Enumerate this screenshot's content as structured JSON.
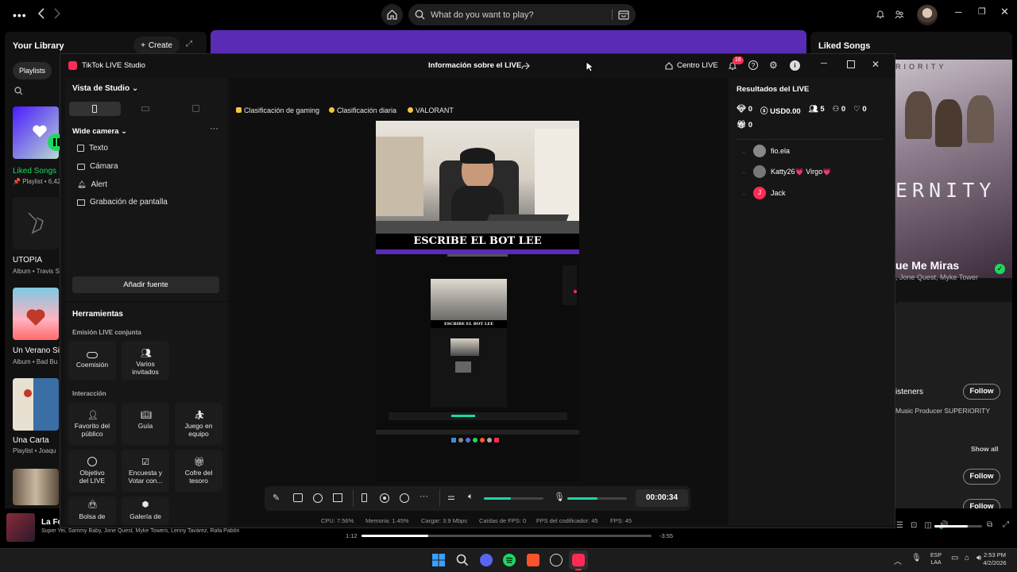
{
  "spotify": {
    "search_placeholder": "What do you want to play?",
    "library_title": "Your Library",
    "create_label": "Create",
    "filter_playlists": "Playlists",
    "library_items": [
      {
        "title": "Liked Songs",
        "subtitle": "Playlist • 6,42",
        "color": "#7b4bff"
      },
      {
        "title": "UTOPIA",
        "subtitle": "Album • Travis S",
        "color": "#2a2a2a"
      },
      {
        "title": "Un Verano Sin",
        "subtitle": "Album • Bad Bu",
        "color": "#ff6b6b"
      },
      {
        "title": "Una Carta",
        "subtitle": "Playlist • Joaqu",
        "color": "#3a6ea5"
      }
    ],
    "right_title": "Liked Songs",
    "banner_text": "ERNITY",
    "banner_top_text": "RIORITY",
    "track_title": "ue Me Miras",
    "track_artists": ", Jone Quest, Myke Tower",
    "listeners_label": "isteners",
    "follow_label": "Follow",
    "producer_text": "Music Producer SUPERIORITY",
    "show_all": "Show all",
    "follow2_label": "Follow",
    "follow3_label": "Follow",
    "now_playing_title": "La Fo",
    "now_playing_artists": "Super Yei, Sammy Baby, Jone Quest, Myke Towers, Lenny Tavárez, Rafa Pabön",
    "elapsed": "1:12",
    "remaining": "-3:55",
    "progress_fraction": 0.23,
    "volume_fraction": 0.7
  },
  "tiktok": {
    "app_title": "TikTok LIVE Studio",
    "live_info": "Información sobre el LIVE",
    "centro_live": "Centro LIVE",
    "notif_count": "16",
    "vista_label": "Vista de Studio",
    "scene_name": "Wide camera",
    "sources": [
      {
        "name": "Texto",
        "icon": "text-icon"
      },
      {
        "name": "Cámara",
        "icon": "camera-icon"
      },
      {
        "name": "Alert",
        "icon": "bell-icon"
      },
      {
        "name": "Grabación de pantalla",
        "icon": "monitor-icon"
      }
    ],
    "add_source": "Añadir fuente",
    "tools_title": "Herramientas",
    "section_joint": "Emisión LIVE conjunta",
    "joint_tools": [
      "Coemisión",
      "Varios invitados"
    ],
    "section_interaction": "Interacción",
    "interaction_tools": [
      "Favorito del público",
      "Guía",
      "Juego en equipo",
      "Objetivo del LIVE",
      "Encuesta y Votar con...",
      "Cofre del tesoro",
      "Bolsa de",
      "Galería de"
    ],
    "tags": [
      "Clasificación de gaming",
      "Clasificación diaria",
      "VALORANT"
    ],
    "preview_caption": "ESCRIBE EL BOT LEE",
    "timer": "00:00:34",
    "mic_level": 0.5,
    "speaker_level": 0.45,
    "stats": {
      "cpu": "CPU: 7.56%",
      "memory": "Memoria: 1.45%",
      "upload": "Cargar: 3.9 Mbps",
      "dropped": "Caídas de FPS: 0",
      "encoder_fps": "FPS del codificador: 45",
      "fps": "FPS: 45"
    },
    "results_title": "Resultados del LIVE",
    "results": {
      "gems": "0",
      "usd": "USD0.00",
      "viewers": "5",
      "shares": "0",
      "likes": "0",
      "gifts": "0"
    },
    "viewers_list": [
      {
        "name": "fio.ela",
        "avatar": "avatar-photo"
      },
      {
        "name": "Katty26💗 Virgo💗",
        "avatar": "avatar-photo"
      },
      {
        "name": "Jack",
        "avatar": "J"
      }
    ]
  },
  "taskbar": {
    "lang": "ESP",
    "lang2": "LAA",
    "time": "2:53 PM",
    "date": "4/2/2026"
  }
}
